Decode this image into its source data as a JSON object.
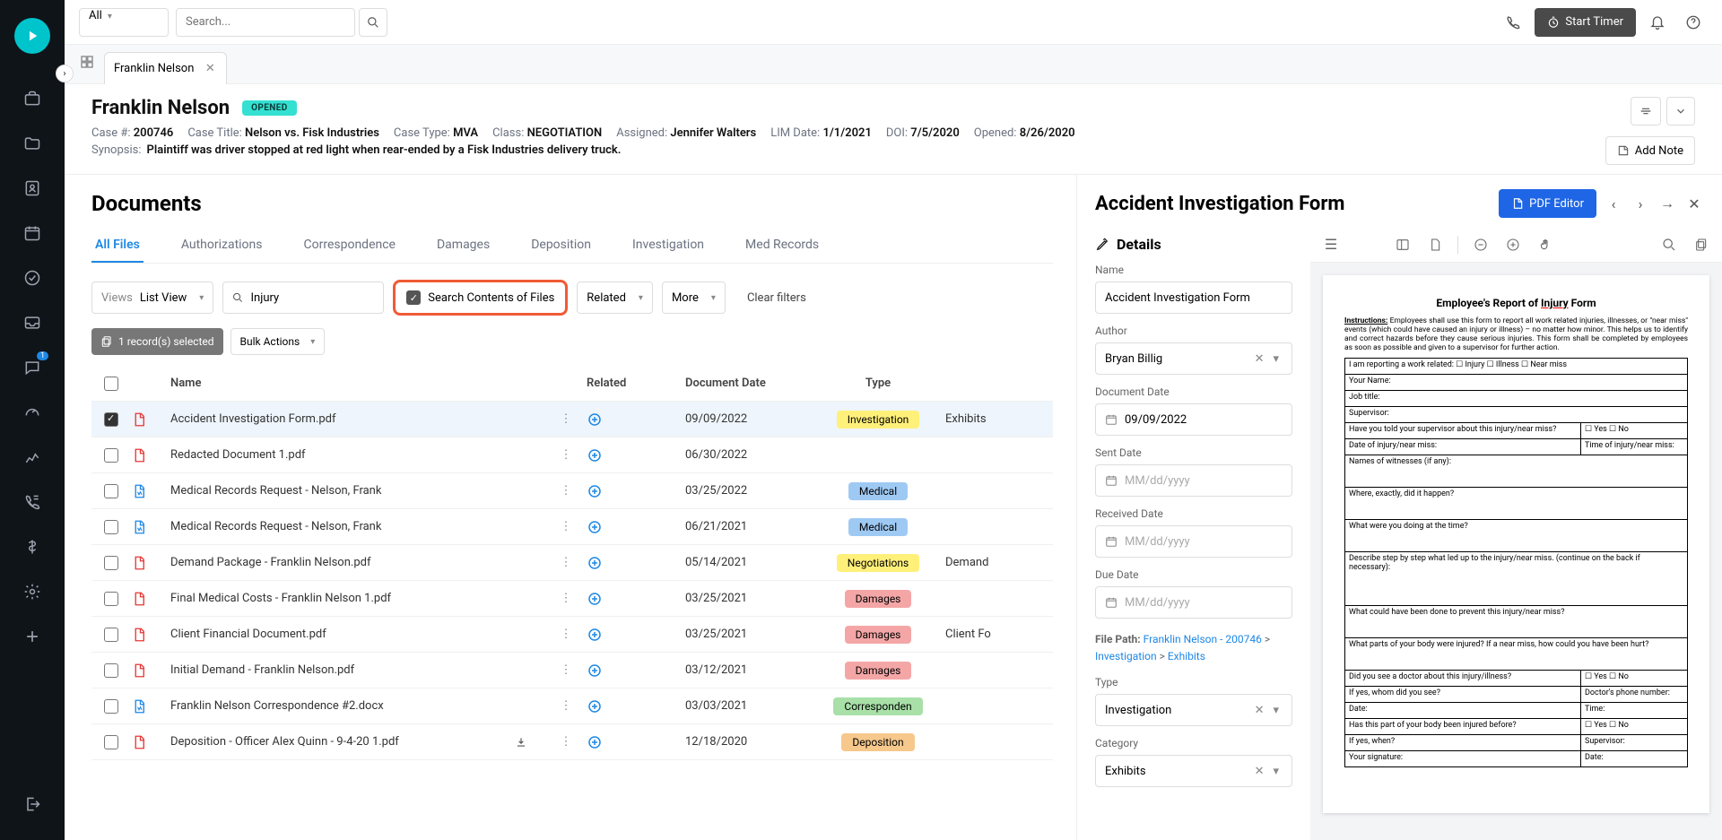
{
  "topbar": {
    "scope": "All",
    "search_placeholder": "Search...",
    "timer": "Start Timer"
  },
  "tab": {
    "label": "Franklin Nelson"
  },
  "header": {
    "title": "Franklin Nelson",
    "status": "OPENED",
    "case_no_label": "Case #:",
    "case_no": "200746",
    "case_title_label": "Case Title:",
    "case_title": "Nelson vs. Fisk Industries",
    "case_type_label": "Case Type:",
    "case_type": "MVA",
    "class_label": "Class:",
    "class": "NEGOTIATION",
    "assigned_label": "Assigned:",
    "assigned": "Jennifer Walters",
    "lim_label": "LIM Date:",
    "lim": "1/1/2021",
    "doi_label": "DOI:",
    "doi": "7/5/2020",
    "opened_label": "Opened:",
    "opened": "8/26/2020",
    "synopsis_label": "Synopsis:",
    "synopsis": "Plaintiff was driver stopped at red light when rear-ended by a Fisk Industries delivery truck.",
    "add_note": "Add Note"
  },
  "docs": {
    "title": "Documents",
    "tabs": [
      "All Files",
      "Authorizations",
      "Correspondence",
      "Damages",
      "Deposition",
      "Investigation",
      "Med Records"
    ],
    "active_tab": 0,
    "views_label": "Views",
    "view_value": "List View",
    "search_value": "Injury",
    "search_contents": "Search Contents of Files",
    "related": "Related",
    "more": "More",
    "clear": "Clear filters",
    "records_selected": "1 record(s) selected",
    "bulk_actions": "Bulk Actions",
    "cols": {
      "name": "Name",
      "related": "Related",
      "date": "Document Date",
      "type": "Type"
    },
    "rows": [
      {
        "checked": true,
        "ftype": "pdf",
        "name": "Accident Investigation Form.pdf",
        "rel": "plus",
        "date": "09/09/2022",
        "type": "Investigation",
        "type_cls": "investigation",
        "category": "Exhibits",
        "download": false
      },
      {
        "checked": false,
        "ftype": "pdf",
        "name": "Redacted Document 1.pdf",
        "rel": "plus",
        "date": "06/30/2022",
        "type": "",
        "type_cls": "",
        "category": "",
        "download": false
      },
      {
        "checked": false,
        "ftype": "doc",
        "name": "Medical Records Request - Nelson, Frank",
        "rel": "plus",
        "date": "03/25/2022",
        "type": "Medical",
        "type_cls": "medical",
        "category": "",
        "download": false
      },
      {
        "checked": false,
        "ftype": "doc",
        "name": "Medical Records Request - Nelson, Frank",
        "rel": "plus",
        "date": "06/21/2021",
        "type": "Medical",
        "type_cls": "medical",
        "category": "",
        "download": false
      },
      {
        "checked": false,
        "ftype": "pdf",
        "name": "Demand Package - Franklin Nelson.pdf",
        "rel": "plus",
        "date": "05/14/2021",
        "type": "Negotiations",
        "type_cls": "negotiations",
        "category": "Demand",
        "download": false
      },
      {
        "checked": false,
        "ftype": "pdf",
        "name": "Final Medical Costs - Franklin Nelson 1.pdf",
        "rel": "plus",
        "date": "03/25/2021",
        "type": "Damages",
        "type_cls": "damages",
        "category": "",
        "download": false
      },
      {
        "checked": false,
        "ftype": "pdf",
        "name": "Client Financial Document.pdf",
        "rel": "plus",
        "date": "03/25/2021",
        "type": "Damages",
        "type_cls": "damages",
        "category": "Client Fo",
        "download": false
      },
      {
        "checked": false,
        "ftype": "pdf",
        "name": "Initial Demand - Franklin Nelson.pdf",
        "rel": "plus-outline",
        "date": "03/12/2021",
        "type": "Damages",
        "type_cls": "damages",
        "category": "",
        "download": false
      },
      {
        "checked": false,
        "ftype": "doc",
        "name": "Franklin Nelson Correspondence #2.docx",
        "rel": "plus-outline",
        "date": "03/03/2021",
        "type": "Corresponden",
        "type_cls": "correspondence",
        "category": "",
        "download": false
      },
      {
        "checked": false,
        "ftype": "pdf",
        "name": "Deposition - Officer Alex Quinn - 9-4-20 1.pdf",
        "rel": "plus-outline",
        "date": "12/18/2020",
        "type": "Deposition",
        "type_cls": "deposition",
        "category": "",
        "download": true
      }
    ]
  },
  "inspector": {
    "title": "Accident Investigation Form",
    "pdf_editor": "PDF Editor",
    "details": "Details",
    "name_label": "Name",
    "name_value": "Accident Investigation Form",
    "author_label": "Author",
    "author_value": "Bryan Billig",
    "docdate_label": "Document Date",
    "docdate_value": "09/09/2022",
    "sent_label": "Sent Date",
    "recv_label": "Received Date",
    "due_label": "Due Date",
    "date_placeholder": "MM/dd/yyyy",
    "file_path_label": "File Path:",
    "file_path_parts": [
      "Franklin Nelson - 200746",
      "Investigation",
      "Exhibits"
    ],
    "type_label": "Type",
    "type_value": "Investigation",
    "category_label": "Category",
    "category_value": "Exhibits"
  },
  "formdoc": {
    "title_pre": "Employee's Report of ",
    "title_hl": "Injury",
    "title_post": " Form",
    "instructions_label": "Instructions:",
    "instructions": "Employees shall use this form to report all work related injuries, illnesses, or \"near miss\" events (which could have caused an injury or illness) – no matter how minor. This helps us to identify and correct hazards before they cause serious injuries. This form shall be completed by employees as soon as possible and given to a supervisor for further action.",
    "r1": "I am reporting a work related:    ☐ Injury    ☐ Illness    ☐ Near miss",
    "r2": "Your Name:",
    "r3": "Job title:",
    "r4": "Supervisor:",
    "r5a": "Have you told your supervisor about this injury/near miss?",
    "r5b": "☐ Yes    ☐ No",
    "r6a": "Date of injury/near miss:",
    "r6b": "Time of injury/near miss:",
    "r7": "Names of witnesses (if any):",
    "r8": "Where, exactly, did it happen?",
    "r9": "What were you doing at the time?",
    "r10": "Describe step by step what led up to the injury/near miss. (continue on the back if necessary):",
    "r11": "What could have been done to prevent this injury/near miss?",
    "r12": "What parts of your body were injured?  If a near miss, how could you have been hurt?",
    "r13a": "Did you see a doctor about this injury/illness?",
    "r13b": "☐ Yes    ☐ No",
    "r14a": "If yes, whom did you see?",
    "r14b": "Doctor's phone number:",
    "r15a": "Date:",
    "r15b": "Time:",
    "r16a": "Has this part of your body been injured before?",
    "r16b": "☐ Yes    ☐ No",
    "r17a": "If yes, when?",
    "r17b": "Supervisor:",
    "r18a": "Your signature:",
    "r18b": "Date:"
  }
}
